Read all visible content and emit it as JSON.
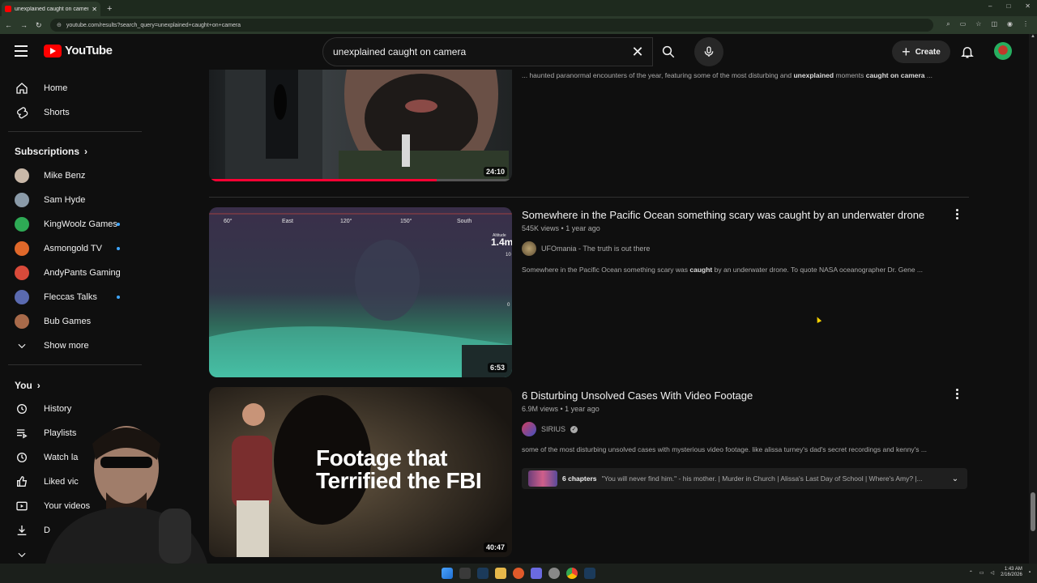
{
  "browser": {
    "tab_title": "unexplained caught on camera",
    "new_tab": "+",
    "url": "youtube.com/results?search_query=unexplained+caught+on+camera",
    "window_controls": [
      "–",
      "□",
      "✕"
    ]
  },
  "header": {
    "logo_text": "YouTube",
    "search_value": "unexplained caught on camera",
    "create_label": "Create"
  },
  "sidebar": {
    "main": [
      {
        "label": "Home",
        "icon": "home-icon"
      },
      {
        "label": "Shorts",
        "icon": "shorts-icon"
      }
    ],
    "subscriptions_title": "Subscriptions",
    "subscriptions": [
      {
        "label": "Mike Benz",
        "color": "#c9b8a8",
        "live": false
      },
      {
        "label": "Sam Hyde",
        "color": "#8a9aa8",
        "live": false
      },
      {
        "label": "KingWoolz Games",
        "color": "#2eaa55",
        "live": true
      },
      {
        "label": "Asmongold TV",
        "color": "#e0682a",
        "live": true
      },
      {
        "label": "AndyPants Gaming",
        "color": "#d94a3a",
        "live": false
      },
      {
        "label": "Fleccas Talks",
        "color": "#5a6ab0",
        "live": true
      },
      {
        "label": "Bub Games",
        "color": "#a86a4a",
        "live": false
      }
    ],
    "show_more": "Show more",
    "you_title": "You",
    "you_items": [
      {
        "label": "History",
        "icon": "history-icon"
      },
      {
        "label": "Playlists",
        "icon": "playlists-icon"
      },
      {
        "label": "Watch la",
        "icon": "watch-later-icon"
      },
      {
        "label": "Liked vic",
        "icon": "like-icon"
      },
      {
        "label": "Your videos",
        "icon": "your-videos-icon"
      },
      {
        "label": "D",
        "icon": "download-icon"
      }
    ]
  },
  "results": [
    {
      "duration": "24:10",
      "description_parts": [
        "... haunted paranormal encounters of the year, featuring some of the most disturbing and ",
        "unexplained",
        " moments ",
        "caught on camera",
        " ..."
      ]
    },
    {
      "title": "Somewhere in the Pacific Ocean something scary was caught by an underwater drone",
      "views": "545K views",
      "age": "1 year ago",
      "channel": "UFOmania - The truth is out there",
      "duration": "6:53",
      "description_parts": [
        "Somewhere in the Pacific Ocean something scary was ",
        "caught",
        " by an underwater drone. To quote NASA oceanographer Dr. Gene ..."
      ],
      "overlay_labels": [
        "60°",
        "East",
        "120°",
        "150°",
        "South",
        "Altitude",
        "1.4m",
        "10",
        "0"
      ]
    },
    {
      "title": "6 Disturbing Unsolved Cases With Video Footage",
      "views": "6.9M views",
      "age": "1 year ago",
      "channel": "SIRIUS",
      "duration": "40:47",
      "thumb_text": "Footage that Terrified the FBI",
      "description": "some of the most disturbing unsolved cases with mysterious video footage. like alissa turney's dad's secret recordings and kenny's ...",
      "chapters_label": "6 chapters",
      "chapters_text": "\"You will never find him.\" - his mother. | Murder in Church | Alissa's Last Day of School | Where's Amy? |..."
    }
  ],
  "taskbar": {
    "clock_time": "1:43 AM",
    "clock_date": "2/16/2026"
  }
}
